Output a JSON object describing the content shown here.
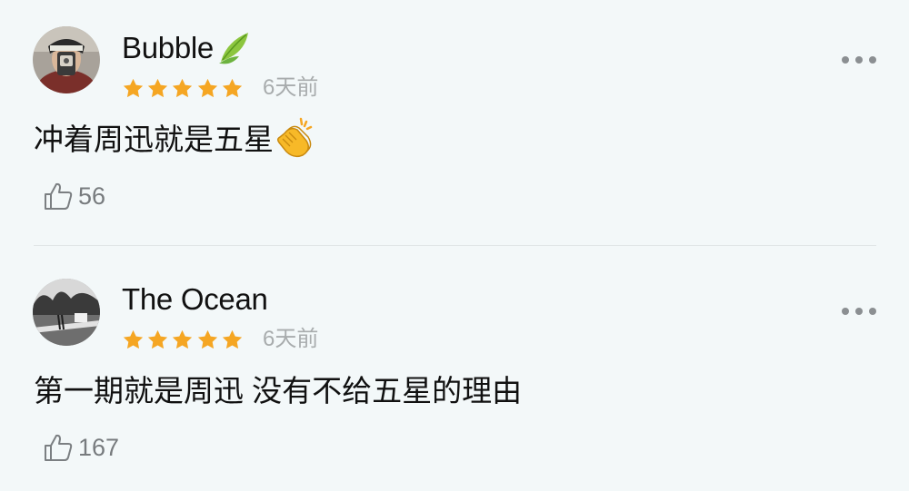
{
  "comments": [
    {
      "username": "Bubble",
      "badge_icon": "leaf-icon",
      "rating": 5,
      "rating_max": 5,
      "time": "6天前",
      "content": "冲着周迅就是五星",
      "content_emoji_icon": "clapping-hands-icon",
      "likes": "56"
    },
    {
      "username": "The Ocean",
      "rating": 5,
      "rating_max": 5,
      "time": "6天前",
      "content": "第一期就是周迅 没有不给五星的理由",
      "likes": "167"
    }
  ],
  "colors": {
    "background": "#f3f8f9",
    "star": "#f5a623",
    "meta_text": "#a8acad",
    "divider": "#e1e6e7"
  }
}
